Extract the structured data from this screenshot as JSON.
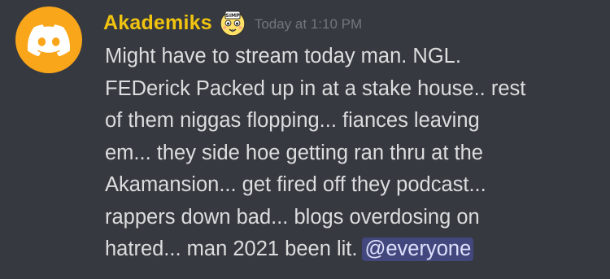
{
  "message": {
    "author": {
      "name": "Akademiks",
      "name_color": "#f1c40f",
      "avatar_color": "#faa61a",
      "avatar_icon": "discord-logo-icon",
      "badge_icon": "simp-emoji-badge-icon",
      "badge_text": "SIMP"
    },
    "timestamp": "Today at 1:10 PM",
    "lines": [
      "Might have to stream today man. NGL.",
      "FEDerick Packed up in at a stake house.. rest",
      "of them niggas flopping... fiances leaving",
      "em... they side hoe getting ran thru at the",
      "Akamansion... get fired off they podcast...",
      "rappers down bad... blogs overdosing on",
      "hatred... man 2021 been lit."
    ],
    "mention": "@everyone"
  },
  "colors": {
    "background": "#36393f",
    "text": "#dcddde",
    "timestamp": "#72767d",
    "mention_text": "#dee0fc"
  }
}
